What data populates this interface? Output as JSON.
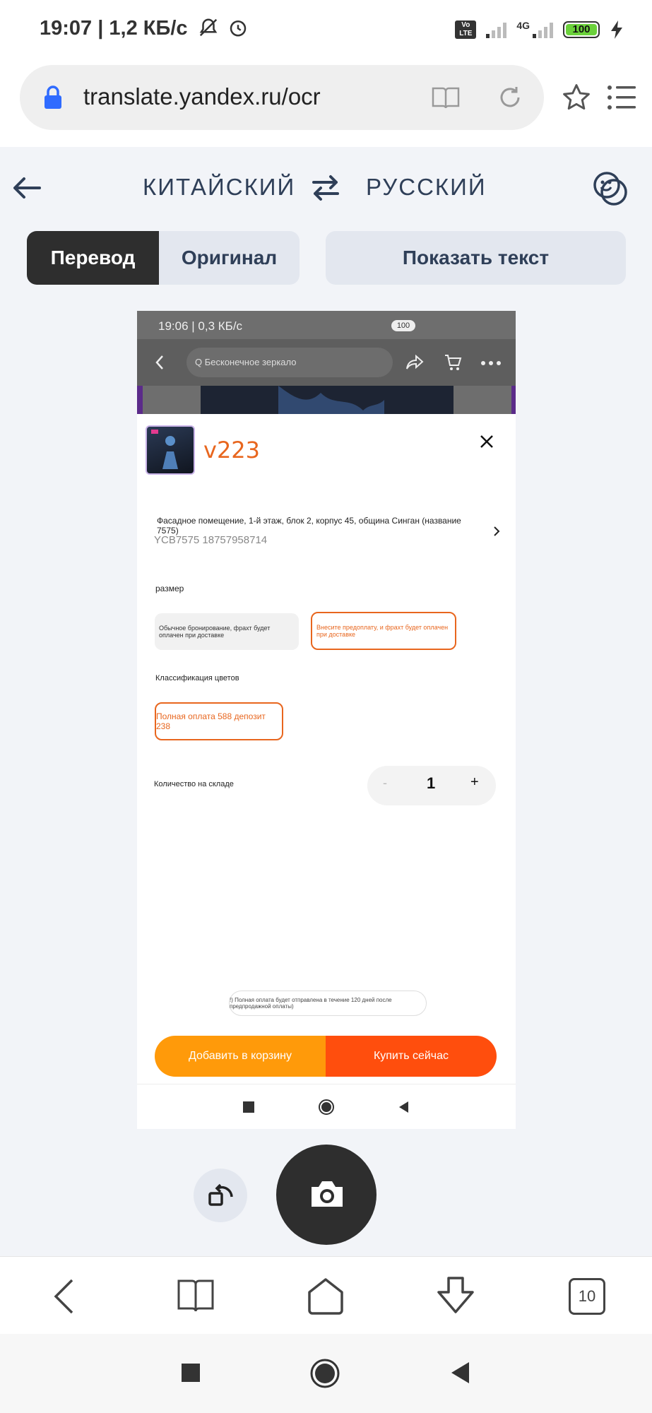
{
  "status_bar": {
    "time_speed": "19:07 | 1,2 КБ/с",
    "network": "4G",
    "volte": "Vo LTE",
    "battery": "100"
  },
  "browser": {
    "url": "translate.yandex.ru/ocr",
    "tabs_count": "10"
  },
  "translator": {
    "source_lang": "КИТАЙСКИЙ",
    "target_lang": "РУССКИЙ",
    "tab_translation": "Перевод",
    "tab_original": "Оригинал",
    "show_text_button": "Показать текст"
  },
  "image": {
    "status_time": "19:06 | 0,3 КБ/с",
    "battery": "100",
    "search_text": "Q Бесконечное зеркало",
    "price": "v223",
    "address": "Фасадное помещение, 1-й этаж, блок 2, корпус 45, община Синган (название 7575)",
    "phone": "YCB7575 18757958714",
    "size_label": "размер",
    "option_booking": "Обычное бронирование, фрахт будет оплачен при доставке",
    "option_prepay": "Внесите предоплату, и фрахт будет оплачен при доставке",
    "color_label": "Классификация цветов",
    "color_option": "Полная оплата 588 депозит 238",
    "stock_label": "Количество на складе",
    "qty_minus": "-",
    "qty_value": "1",
    "qty_plus": "+",
    "note": "!) Полная оплата будет отправлена в течение 120 дней после предпродажной оплаты)",
    "add_to_cart": "Добавить в корзину",
    "buy_now": "Купить сейчас"
  },
  "colors": {
    "accent_orange": "#ff4e0d",
    "cart_orange": "#ff9a0a",
    "price_orange": "#e8661e",
    "dark_button": "#2e2e2e"
  },
  "icons": [
    "lock-icon",
    "reader-icon",
    "reload-icon",
    "star-icon",
    "menu-icon",
    "back-arrow-icon",
    "swap-icon",
    "feedback-icon",
    "rotate-icon",
    "camera-icon",
    "chevron-left-icon",
    "book-icon",
    "home-icon",
    "download-icon"
  ]
}
